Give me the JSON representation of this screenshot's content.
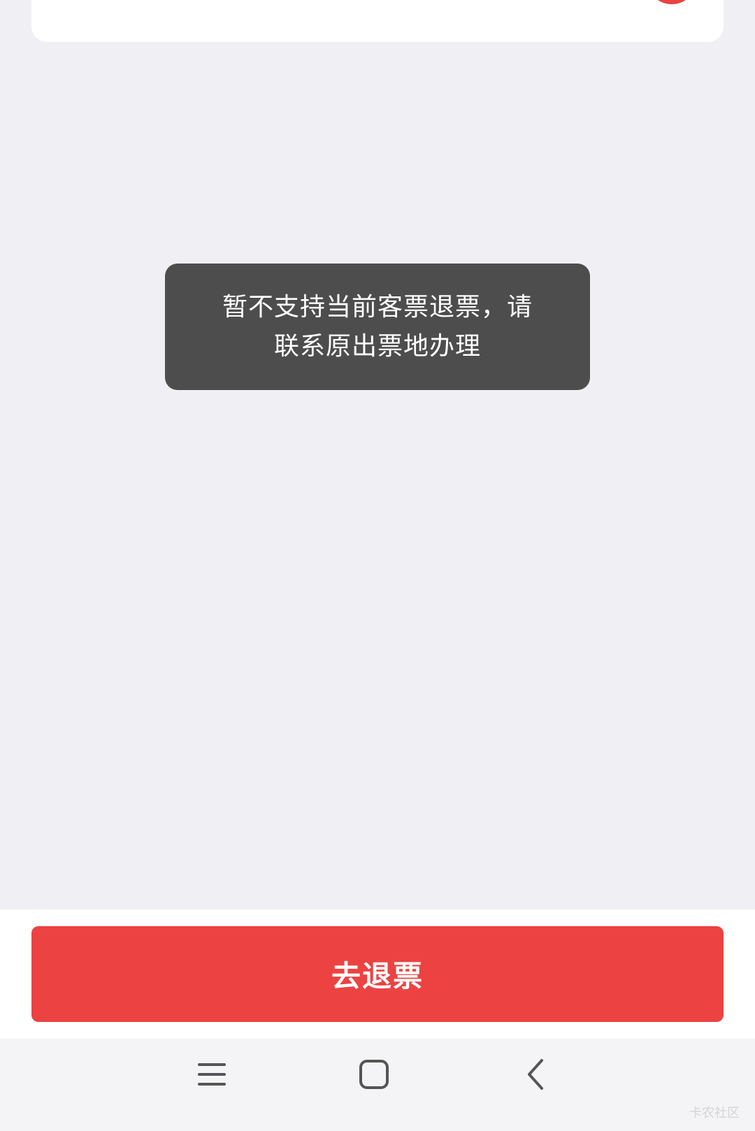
{
  "toast": {
    "message": "暂不支持当前客票退票，请\n联系原出票地办理"
  },
  "actions": {
    "refund_button_label": "去退票"
  },
  "system_nav": {
    "menu_icon": "menu-icon",
    "home_icon": "home-icon",
    "back_icon": "back-icon"
  },
  "watermark": {
    "text": "卡农社区"
  },
  "colors": {
    "accent": "#ec4242",
    "page_background": "#efeff4",
    "toast_background": "#4d4d4d"
  }
}
